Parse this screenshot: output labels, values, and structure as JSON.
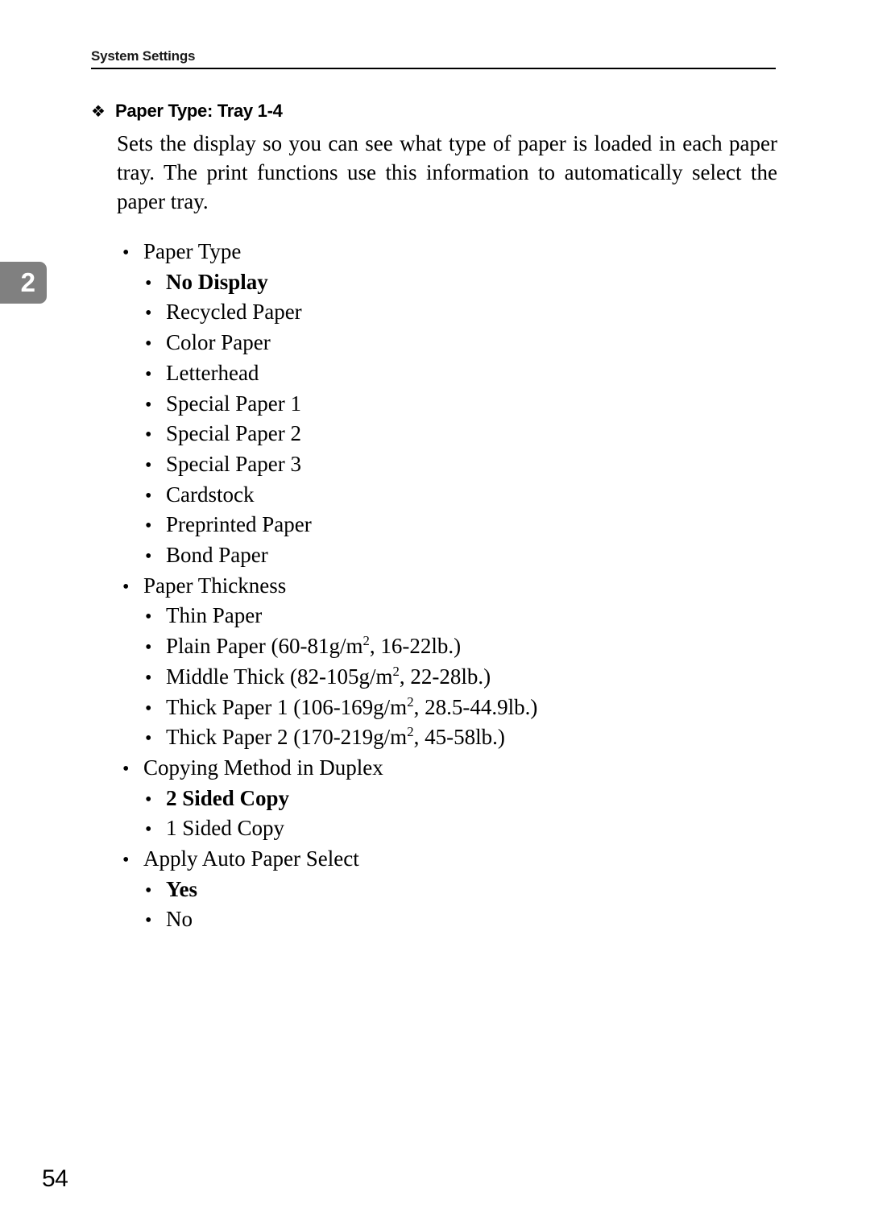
{
  "header": {
    "title": "System Settings"
  },
  "chapter_tab": {
    "number": "2"
  },
  "section": {
    "bullet_glyph": "❖",
    "heading": "Paper Type: Tray 1-4",
    "intro": "Sets the display so you can see what type of paper is loaded in each paper tray. The print functions use this information to automatically select the paper tray."
  },
  "bullets": {
    "level1_glyph": "•",
    "level2_glyph": "•"
  },
  "items": [
    {
      "level": 1,
      "bold": false,
      "text": "Paper Type"
    },
    {
      "level": 2,
      "bold": true,
      "text": "No Display"
    },
    {
      "level": 2,
      "bold": false,
      "text": "Recycled Paper"
    },
    {
      "level": 2,
      "bold": false,
      "text": "Color Paper"
    },
    {
      "level": 2,
      "bold": false,
      "text": "Letterhead"
    },
    {
      "level": 2,
      "bold": false,
      "text": "Special Paper 1"
    },
    {
      "level": 2,
      "bold": false,
      "text": "Special Paper 2"
    },
    {
      "level": 2,
      "bold": false,
      "text": "Special Paper 3"
    },
    {
      "level": 2,
      "bold": false,
      "text": "Cardstock"
    },
    {
      "level": 2,
      "bold": false,
      "text": "Preprinted Paper"
    },
    {
      "level": 2,
      "bold": false,
      "text": "Bond Paper"
    },
    {
      "level": 1,
      "bold": false,
      "text": "Paper Thickness"
    },
    {
      "level": 2,
      "bold": false,
      "text": "Thin Paper"
    },
    {
      "level": 2,
      "bold": false,
      "html": "Plain Paper (60-81g/m<sup>2</sup>, 16-22lb.)",
      "text": "Plain Paper (60-81g/m2, 16-22lb.)"
    },
    {
      "level": 2,
      "bold": false,
      "html": "Middle Thick (82-105g/m<sup>2</sup>, 22-28lb.)",
      "text": "Middle Thick (82-105g/m2, 22-28lb.)"
    },
    {
      "level": 2,
      "bold": false,
      "html": "Thick Paper 1 (106-169g/m<sup>2</sup>, 28.5-44.9lb.)",
      "text": "Thick Paper 1 (106-169g/m2, 28.5-44.9lb.)"
    },
    {
      "level": 2,
      "bold": false,
      "html": "Thick Paper 2 (170-219g/m<sup>2</sup>, 45-58lb.)",
      "text": "Thick Paper 2 (170-219g/m2, 45-58lb.)"
    },
    {
      "level": 1,
      "bold": false,
      "text": "Copying Method in Duplex"
    },
    {
      "level": 2,
      "bold": true,
      "text": "2 Sided Copy"
    },
    {
      "level": 2,
      "bold": false,
      "text": "1 Sided Copy"
    },
    {
      "level": 1,
      "bold": false,
      "text": "Apply Auto Paper Select"
    },
    {
      "level": 2,
      "bold": true,
      "text": "Yes"
    },
    {
      "level": 2,
      "bold": false,
      "text": "No"
    }
  ],
  "folio": {
    "page_number": "54"
  }
}
